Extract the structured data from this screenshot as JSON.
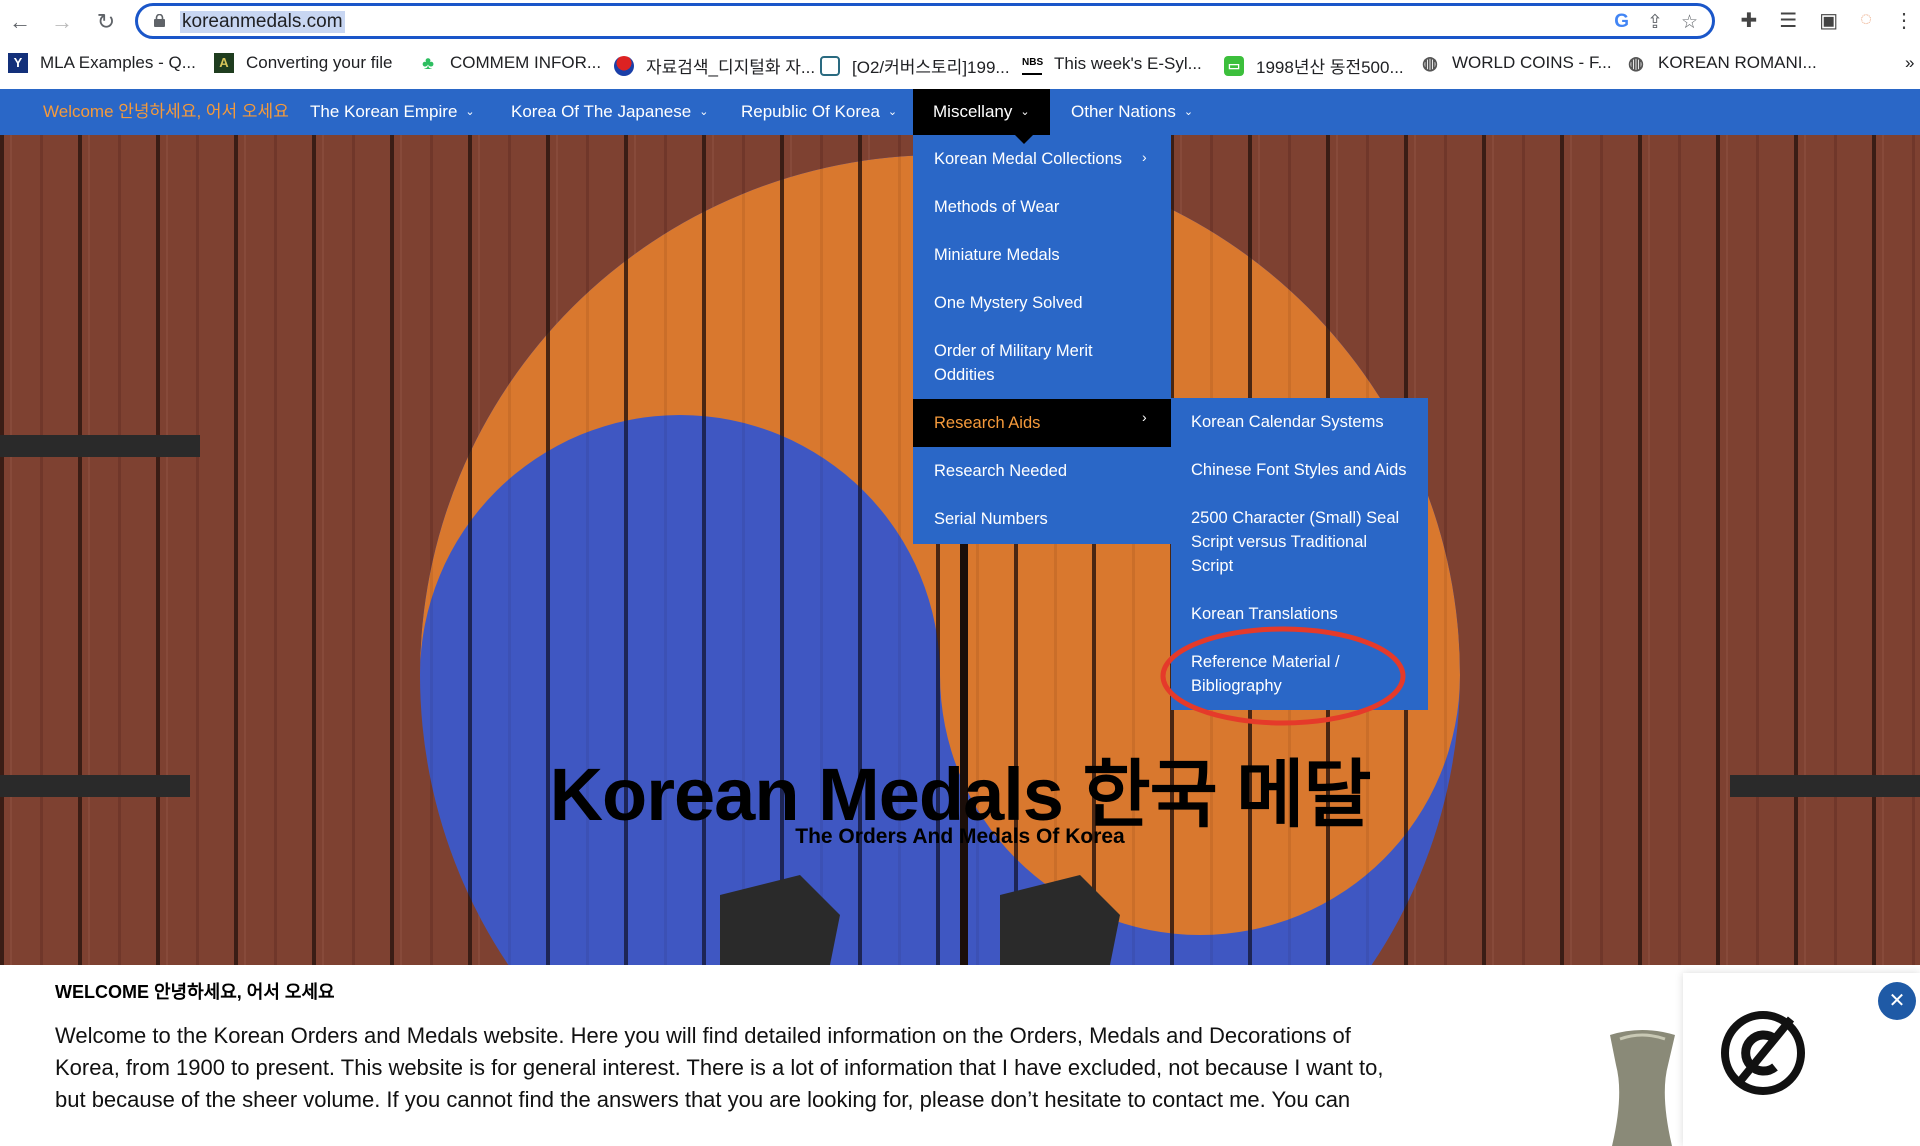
{
  "browser": {
    "url": "koreanmedals.com",
    "bookmarks": [
      {
        "label": "MLA Examples - Q...",
        "icon": "yale-icon"
      },
      {
        "label": "Converting your file",
        "icon": "converter-icon"
      },
      {
        "label": "COMMEM INFOR...",
        "icon": "evernote-icon"
      },
      {
        "label": "자료검색_디지털화 자...",
        "icon": "korea-flag-icon"
      },
      {
        "label": "[O2/커버스토리]199...",
        "icon": "globe-pattern-icon"
      },
      {
        "label": "This week's E-Syl...",
        "icon": "nbs-icon"
      },
      {
        "label": "1998년산 동전500...",
        "icon": "chat-icon"
      },
      {
        "label": "WORLD COINS - F...",
        "icon": "globe-icon"
      },
      {
        "label": "KOREAN ROMANI...",
        "icon": "globe-icon"
      }
    ],
    "more_bookmarks": "»"
  },
  "nav": {
    "welcome": "Welcome 안녕하세요, 어서 오세요",
    "items": [
      {
        "label": "The Korean Empire"
      },
      {
        "label": "Korea Of The Japanese"
      },
      {
        "label": "Republic Of Korea"
      },
      {
        "label": "Miscellany"
      },
      {
        "label": "Other Nations"
      }
    ]
  },
  "dropdown": {
    "items": [
      {
        "label": "Korean Medal Collections",
        "has_sub": true
      },
      {
        "label": "Methods of Wear"
      },
      {
        "label": "Miniature Medals"
      },
      {
        "label": "One Mystery Solved"
      },
      {
        "label": "Order of Military Merit Oddities"
      },
      {
        "label": "Research Aids",
        "has_sub": true,
        "selected": true
      },
      {
        "label": "Research Needed"
      },
      {
        "label": "Serial Numbers"
      }
    ],
    "submenu": [
      {
        "label": "Korean Calendar Systems"
      },
      {
        "label": "Chinese Font Styles and Aids"
      },
      {
        "label": "2500 Character (Small) Seal Script versus Traditional Script"
      },
      {
        "label": "Korean Translations"
      },
      {
        "label": "Reference Material / Bibliography",
        "highlighted": true
      }
    ]
  },
  "hero": {
    "title": "Korean Medals 한국 메달",
    "subtitle": "The Orders And Medals Of Korea"
  },
  "content": {
    "heading": "WELCOME 안녕하세요, 어서 오세요",
    "paragraph": "Welcome to the Korean Orders and Medals website. Here you will find detailed information on the Orders, Medals and Decorations of Korea, from 1900 to present. This website is for general interest. There is a lot of information that I have excluded, not because I want to, but because of the sheer volume. If you cannot find the answers that you are looking for, please don’t hesitate to contact me. You can"
  },
  "colors": {
    "nav_bg": "#2a67c7",
    "accent_orange": "#f59a3b",
    "highlight_circle": "#e53a2a"
  }
}
